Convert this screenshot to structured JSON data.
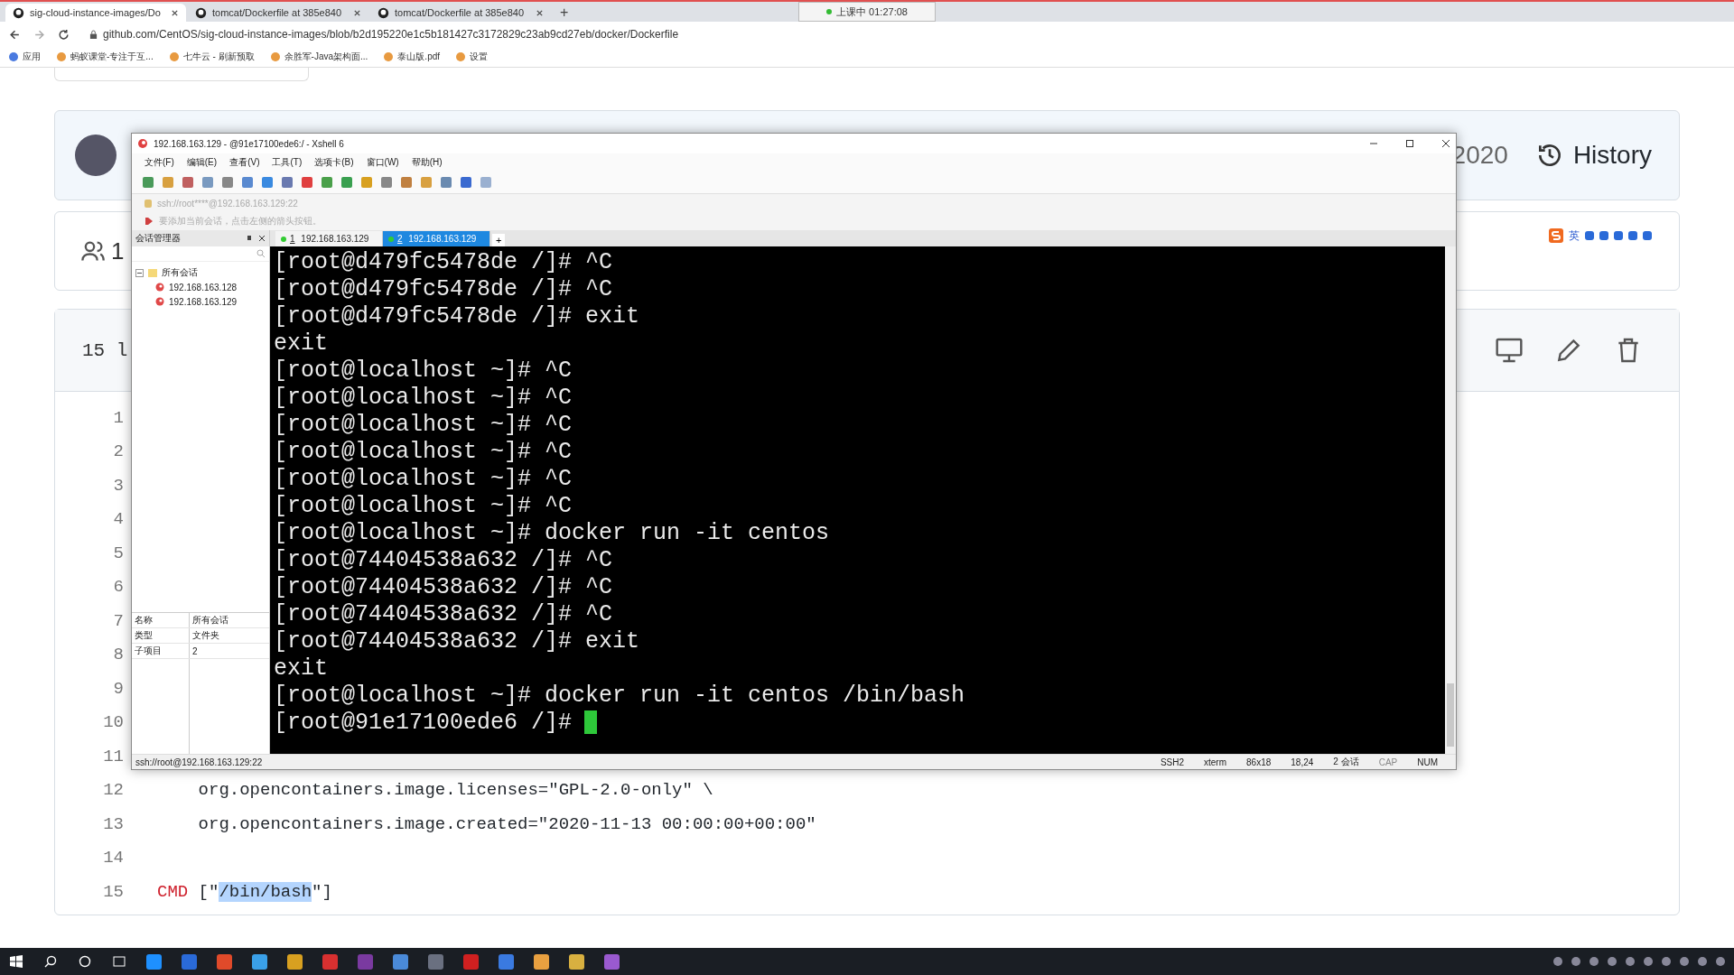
{
  "browser": {
    "tabs": [
      {
        "title": "sig-cloud-instance-images/Do",
        "selected": true
      },
      {
        "title": "tomcat/Dockerfile at 385e840",
        "selected": false
      },
      {
        "title": "tomcat/Dockerfile at 385e840",
        "selected": false
      }
    ],
    "new_tab": "+",
    "recording": "上课中 01:27:08",
    "address": "github.com/CentOS/sig-cloud-instance-images/blob/b2d195220e1c5b181427c3172829c23ab9cd27eb/docker/Dockerfile",
    "bookmarks": [
      "应用",
      "蚂蚁课堂-专注于互...",
      "七牛云 - 刷新预取",
      "余胜军-Java架构面...",
      "泰山版.pdf",
      "设置"
    ]
  },
  "page": {
    "commit_date": "2020",
    "history": "History",
    "contributors": "1",
    "file_info": "15 l",
    "ime": "英",
    "code_lines": [
      {
        "number": "1"
      },
      {
        "number": "2"
      },
      {
        "number": "3"
      },
      {
        "number": "4"
      },
      {
        "number": "5"
      },
      {
        "number": "6"
      },
      {
        "number": "7"
      },
      {
        "number": "8"
      },
      {
        "number": "9"
      },
      {
        "number": "10"
      },
      {
        "number": "11"
      },
      {
        "number": "12",
        "tokens": [
          {
            "kind": "plain",
            "text": "    org.opencontainers.image.licenses=\"GPL-2.0-only\" \\"
          }
        ]
      },
      {
        "number": "13",
        "tokens": [
          {
            "kind": "plain",
            "text": "    org.opencontainers.image.created=\"2020-11-13 00:00:00+00:00\""
          }
        ]
      },
      {
        "number": "14"
      },
      {
        "number": "15",
        "tokens": [
          {
            "kind": "keyword",
            "text": "CMD"
          },
          {
            "kind": "plain",
            "text": " [\""
          },
          {
            "kind": "selected",
            "text": "/bin/bash"
          },
          {
            "kind": "plain",
            "text": "\"]"
          }
        ]
      }
    ]
  },
  "xshell": {
    "title": "192.168.163.129 - @91e17100ede6:/ - Xshell 6",
    "menu": [
      "文件(F)",
      "编辑(E)",
      "查看(V)",
      "工具(T)",
      "选项卡(B)",
      "窗口(W)",
      "帮助(H)"
    ],
    "address": "ssh://root****@192.168.163.129:22",
    "hint": "要添加当前会话，点击左侧的箭头按钮。",
    "session_manager": {
      "title": "会话管理器",
      "tree": [
        {
          "label": "所有会话",
          "expanded": true,
          "children": [
            {
              "label": "192.168.163.128"
            },
            {
              "label": "192.168.163.129"
            }
          ]
        }
      ],
      "properties": [
        {
          "name": "名称",
          "value": "所有会话"
        },
        {
          "name": "类型",
          "value": "文件夹"
        },
        {
          "name": "子项目",
          "value": "2"
        }
      ]
    },
    "tabs": [
      {
        "number": "1",
        "label": "192.168.163.129",
        "selected": false
      },
      {
        "number": "2",
        "label": "192.168.163.129",
        "selected": true
      }
    ],
    "new_tab": "+",
    "terminal": {
      "cursor": true,
      "lines": [
        "[root@d479fc5478de /]# ^C",
        "[root@d479fc5478de /]# ^C",
        "[root@d479fc5478de /]# exit",
        "exit",
        "[root@localhost ~]# ^C",
        "[root@localhost ~]# ^C",
        "[root@localhost ~]# ^C",
        "[root@localhost ~]# ^C",
        "[root@localhost ~]# ^C",
        "[root@localhost ~]# ^C",
        "[root@localhost ~]# docker run -it centos",
        "[root@74404538a632 /]# ^C",
        "[root@74404538a632 /]# ^C",
        "[root@74404538a632 /]# ^C",
        "[root@74404538a632 /]# exit",
        "exit",
        "[root@localhost ~]# docker run -it centos /bin/bash",
        "[root@91e17100ede6 /]#"
      ]
    },
    "status_bar": {
      "connection": "ssh://root@192.168.163.129:22",
      "items": [
        {
          "text": "SSH2",
          "on": true
        },
        {
          "text": "xterm",
          "on": true
        },
        {
          "text": "86x18",
          "on": true
        },
        {
          "text": "18,24",
          "on": true
        },
        {
          "text": "2 会话",
          "on": true
        },
        {
          "text": "CAP",
          "on": false
        },
        {
          "text": "NUM",
          "on": true
        }
      ]
    }
  }
}
